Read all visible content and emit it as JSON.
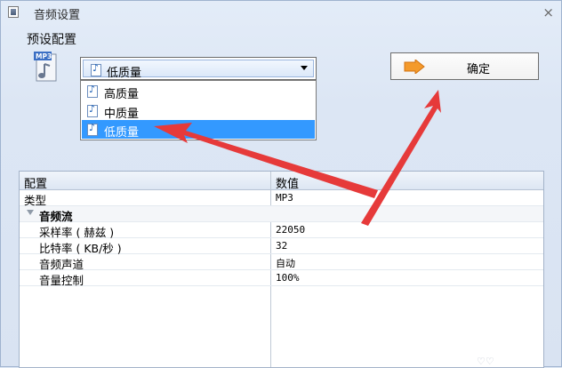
{
  "window": {
    "title": "音频设置",
    "close_glyph": "×",
    "icon": "app-window-icon"
  },
  "preset": {
    "label": "预设配置",
    "format_icon_text": "MP3",
    "selected": "低质量",
    "options": [
      "高质量",
      "中质量",
      "低质量"
    ],
    "selected_index": 2
  },
  "ok_button": {
    "label": "确定",
    "icon": "arrow-right-icon"
  },
  "grid": {
    "headers": [
      "配置",
      "数值"
    ],
    "rows": [
      {
        "key": "类型",
        "value": "MP3"
      },
      {
        "key": "音频流",
        "value": "",
        "group": true
      },
      {
        "key": "采样率 ( 赫兹 )",
        "value": "22050"
      },
      {
        "key": "比特率 ( KB/秒 )",
        "value": "32"
      },
      {
        "key": "音频声道",
        "value": "自动"
      },
      {
        "key": "音量控制",
        "value": "100%"
      }
    ]
  },
  "watermark": "♡♡",
  "colors": {
    "selection": "#3399ff",
    "annotation_arrow": "#e63535"
  }
}
